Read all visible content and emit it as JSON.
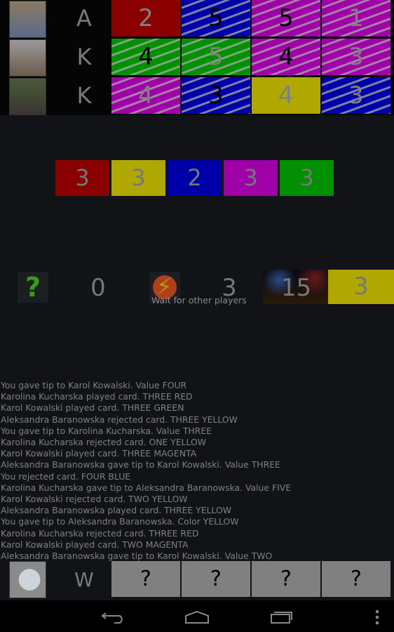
{
  "players": [
    {
      "avatar": "woman-photo",
      "initial": "A",
      "cards": [
        {
          "value": "2",
          "color": "red",
          "striped": false,
          "text": "grey"
        },
        {
          "value": "5",
          "color": "blue",
          "striped": true,
          "text": "black"
        },
        {
          "value": "5",
          "color": "magenta",
          "striped": true,
          "text": "black"
        },
        {
          "value": "1",
          "color": "magenta",
          "striped": true,
          "text": "grey"
        }
      ]
    },
    {
      "avatar": "man-photo",
      "initial": "K",
      "cards": [
        {
          "value": "4",
          "color": "green",
          "striped": true,
          "text": "black"
        },
        {
          "value": "5",
          "color": "green",
          "striped": true,
          "text": "grey"
        },
        {
          "value": "4",
          "color": "magenta",
          "striped": true,
          "text": "black"
        },
        {
          "value": "3",
          "color": "magenta",
          "striped": true,
          "text": "grey"
        }
      ]
    },
    {
      "avatar": "wombat-photo",
      "initial": "K",
      "cards": [
        {
          "value": "4",
          "color": "magenta",
          "striped": true,
          "text": "grey"
        },
        {
          "value": "3",
          "color": "blue",
          "striped": true,
          "text": "black"
        },
        {
          "value": "4",
          "color": "yellow",
          "striped": false,
          "text": "grey"
        },
        {
          "value": "3",
          "color": "blue",
          "striped": true,
          "text": "grey"
        }
      ]
    }
  ],
  "fireworks": [
    {
      "value": "3",
      "color": "#8a0000"
    },
    {
      "value": "3",
      "color": "#b0a800"
    },
    {
      "value": "2",
      "color": "#0000a8"
    },
    {
      "value": "3",
      "color": "#a000a8"
    },
    {
      "value": "3",
      "color": "#009000"
    }
  ],
  "status": {
    "tips_icon": "question-icon",
    "tips": "0",
    "lives_icon": "lightning-icon",
    "lives": "3",
    "deck_icon": "fireworks-image",
    "deck": "15",
    "discard": "3",
    "discard_color": "#b0a800",
    "message": "Wait for other players"
  },
  "log": [
    "You gave tip to Karol Kowalski. Value FOUR",
    "Karolina Kucharska played card. THREE RED",
    "Karol Kowalski played card. THREE GREEN",
    "Aleksandra Baranowska rejected card. THREE YELLOW",
    "You gave tip to Karolina Kucharska. Value THREE",
    "Karolina Kucharska rejected card. ONE YELLOW",
    "Karol Kowalski played card. THREE MAGENTA",
    "Aleksandra Baranowska gave tip to Karol Kowalski. Value THREE",
    "You rejected card. FOUR BLUE",
    "Karolina Kucharska gave tip to Aleksandra Baranowska. Value FIVE",
    "Karol Kowalski rejected card. TWO YELLOW",
    "Aleksandra Baranowska played card. THREE YELLOW",
    "You gave tip to Aleksandra Baranowska. Color YELLOW",
    "Karolina Kucharska rejected card. THREE RED",
    "Karol Kowalski played card. TWO MAGENTA",
    "Aleksandra Baranowska gave tip to Karol Kowalski. Value TWO"
  ],
  "me": {
    "avatar": "sheep-image",
    "initial": "W",
    "cards": [
      "?",
      "?",
      "?",
      "?"
    ]
  }
}
